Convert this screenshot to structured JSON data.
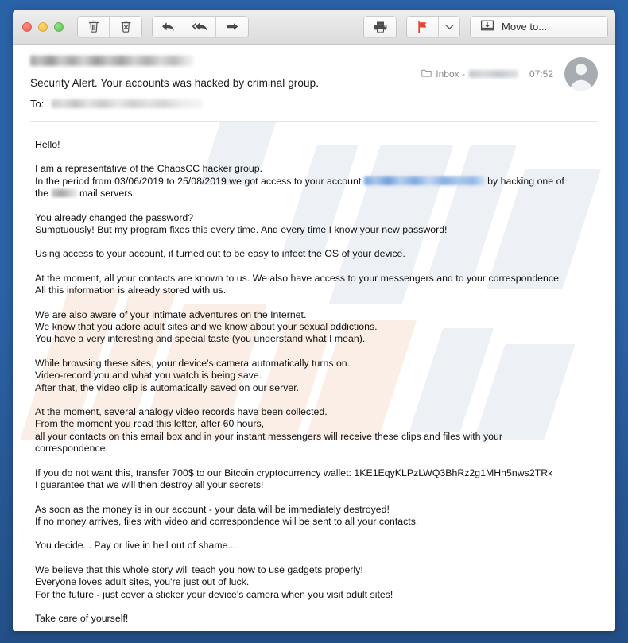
{
  "window": {
    "traffic_lights": [
      "close",
      "minimize",
      "maximize"
    ]
  },
  "toolbar": {
    "delete_label": "Delete",
    "junk_label": "Junk",
    "reply_label": "Reply",
    "reply_all_label": "Reply All",
    "forward_label": "Forward",
    "print_label": "Print",
    "flag_label": "Flag",
    "flag_menu_label": "Flag options",
    "move_to_label": "Move to...",
    "flag_color": "#e8402a"
  },
  "message": {
    "sender_redacted": true,
    "subject": "Security Alert. Your accounts was hacked by criminal group.",
    "to_label": "To:",
    "recipient_redacted": true,
    "mailbox_prefix": "Inbox - ",
    "mailbox_redacted": true,
    "timestamp": "07:52",
    "avatar": "person-placeholder"
  },
  "body": {
    "greeting": "Hello!",
    "p1_line1": "I am a representative of the ChaosCC hacker group.",
    "p1_line2_a": "In the period from 03/06/2019 to 25/08/2019 we got access to your account ",
    "p1_line2_b": " by hacking one of",
    "p1_line3_a": "the ",
    "p1_line3_b": " mail servers.",
    "p2_line1": "You already changed the password?",
    "p2_line2": "Sumptuously! But my program fixes this every time. And every time I know your new password!",
    "p3_line1": "Using access to your account, it turned out to be easy to infect the OS of your device.",
    "p4_line1": "At the moment, all your contacts are known to us. We also have access to your messengers and to your correspondence.",
    "p4_line2": "All this information is already stored with us.",
    "p5_line1": "We are also aware of your intimate adventures on the Internet.",
    "p5_line2": "We know that you adore adult sites and we know about your sexual addictions.",
    "p5_line3": "You have a very interesting and special taste (you understand what I mean).",
    "p6_line1": "While browsing these sites, your device's camera automatically turns on.",
    "p6_line2": "Video-record you and what you watch is being save.",
    "p6_line3": "After that, the video clip is automatically saved on our server.",
    "p7_line1": "At the moment, several analogy video records have been collected.",
    "p7_line2": "From the moment you read this letter, after 60 hours,",
    "p7_line3": "all your contacts on this email box and in your instant messengers will receive these clips and files with your",
    "p7_line4": "correspondence.",
    "p8_line1": "If you do not want this, transfer 700$ to our Bitcoin cryptocurrency wallet: 1KE1EqyKLPzLWQ3BhRz2g1MHh5nws2TRk",
    "p8_line2": "I guarantee that we will then destroy all your secrets!",
    "p9_line1": "As soon as the money is in our account - your data will be immediately destroyed!",
    "p9_line2": "If no money arrives, files with video and correspondence will be sent to all your contacts.",
    "p10_line1": "You decide... Pay or live in hell out of shame...",
    "p11_line1": "We believe that this whole story will teach you how to use gadgets properly!",
    "p11_line2": "Everyone loves adult sites, you're just out of luck.",
    "p11_line3": "For the future - just cover a sticker your device's camera when you visit adult sites!",
    "p12_line1": "Take care of yourself!",
    "ransom_amount": "700$",
    "bitcoin_wallet": "1KE1EqyKLPzLWQ3BhRz2g1MHh5nws2TRk",
    "period_start": "03/06/2019",
    "period_end": "25/08/2019",
    "deadline_hours": "60 hours",
    "group_name": "ChaosCC"
  }
}
